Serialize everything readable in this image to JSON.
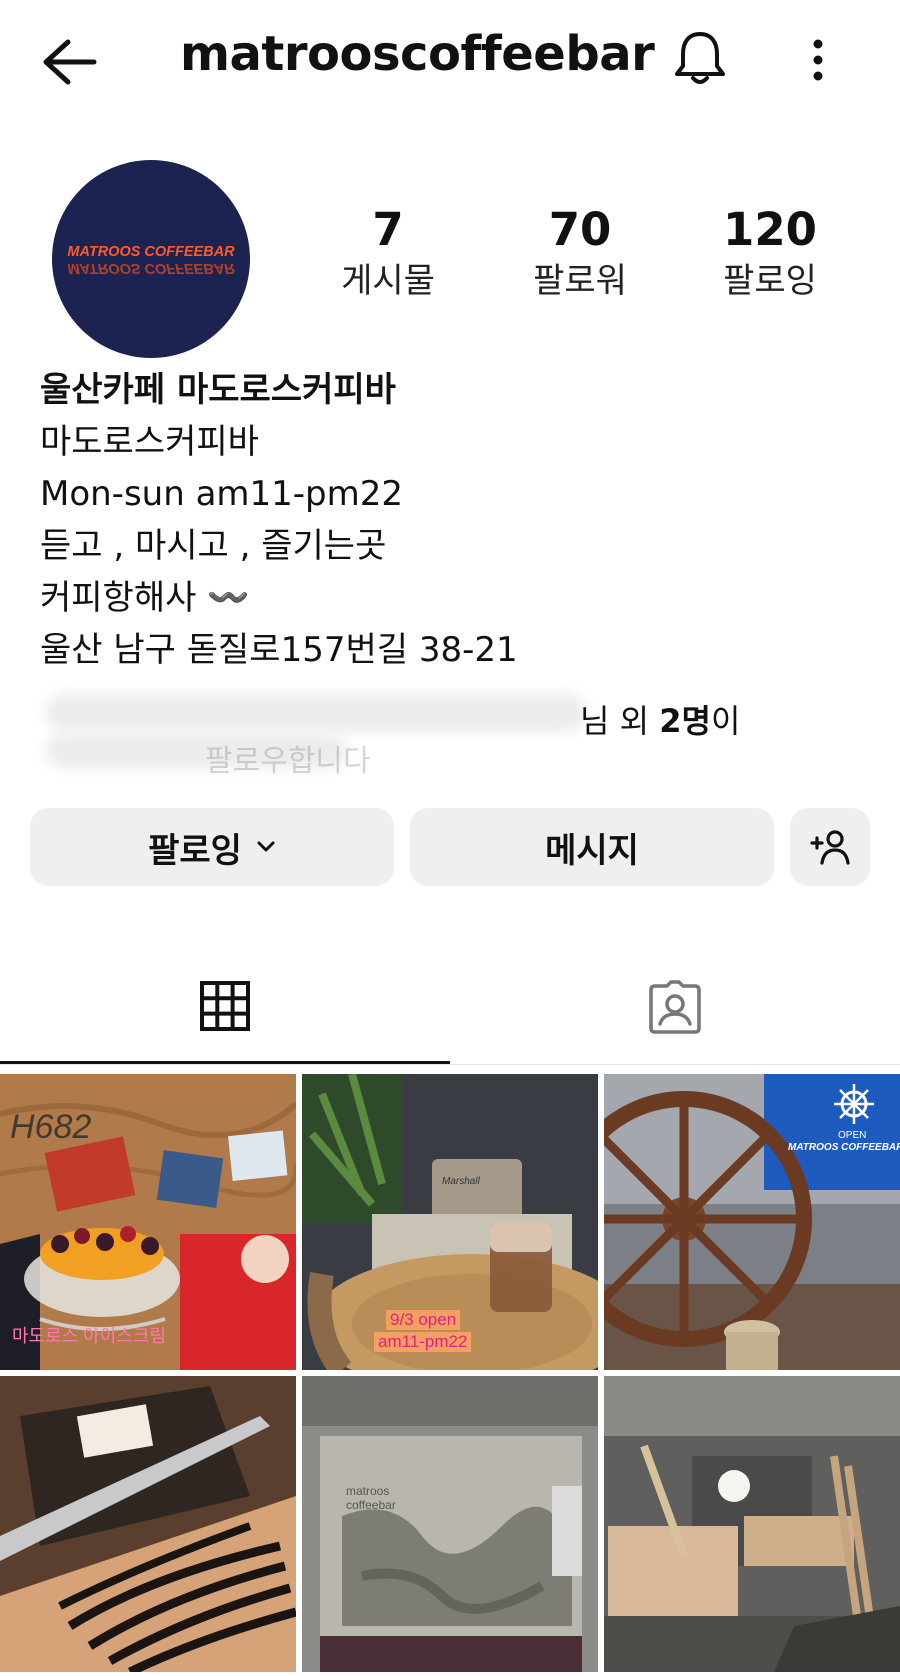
{
  "header": {
    "username": "matrooscoffeebar",
    "back_icon": "arrow-left-icon",
    "notification_icon": "bell-icon",
    "more_icon": "more-vertical-icon"
  },
  "profile": {
    "avatar_text": "MATROOS COFFEEBAR",
    "stats": [
      {
        "value": "7",
        "label": "게시물"
      },
      {
        "value": "70",
        "label": "팔로워"
      },
      {
        "value": "120",
        "label": "팔로잉"
      }
    ],
    "bio": {
      "name": "울산카페 마도로스커피바",
      "lines": [
        "마도로스커피바",
        "Mon-sun am11-pm22",
        "듣고 , 마시고 , 즐기는곳",
        "커피항해사 〰️",
        "울산 남구 돋질로157번길 38-21"
      ]
    },
    "followed_by": {
      "suffix": "님 외",
      "count": "2명",
      "tail": "이",
      "second_line": "팔로우합니다"
    }
  },
  "actions": {
    "follow_label": "팔로잉",
    "message_label": "메시지",
    "add_user_icon": "add-user-icon"
  },
  "tabs": [
    {
      "icon": "grid-icon",
      "active": true
    },
    {
      "icon": "tagged-person-icon",
      "active": false
    }
  ],
  "posts": [
    {
      "caption": "마도로스 아이스크림",
      "handwriting": "H682"
    },
    {
      "caption_lines": [
        "9/3 open",
        "am11-pm22"
      ],
      "brand": "Marshall"
    },
    {
      "caption_lines": [
        "OPEN",
        "MATROOS COFFEEBAR"
      ]
    },
    {
      "caption": ""
    },
    {
      "caption_lines": [
        "matroos",
        "coffeebar"
      ]
    },
    {
      "caption": ""
    }
  ],
  "colors": {
    "avatar_bg": "#1c2350",
    "avatar_text": "#ff5a2a",
    "button_bg": "#efefef"
  }
}
